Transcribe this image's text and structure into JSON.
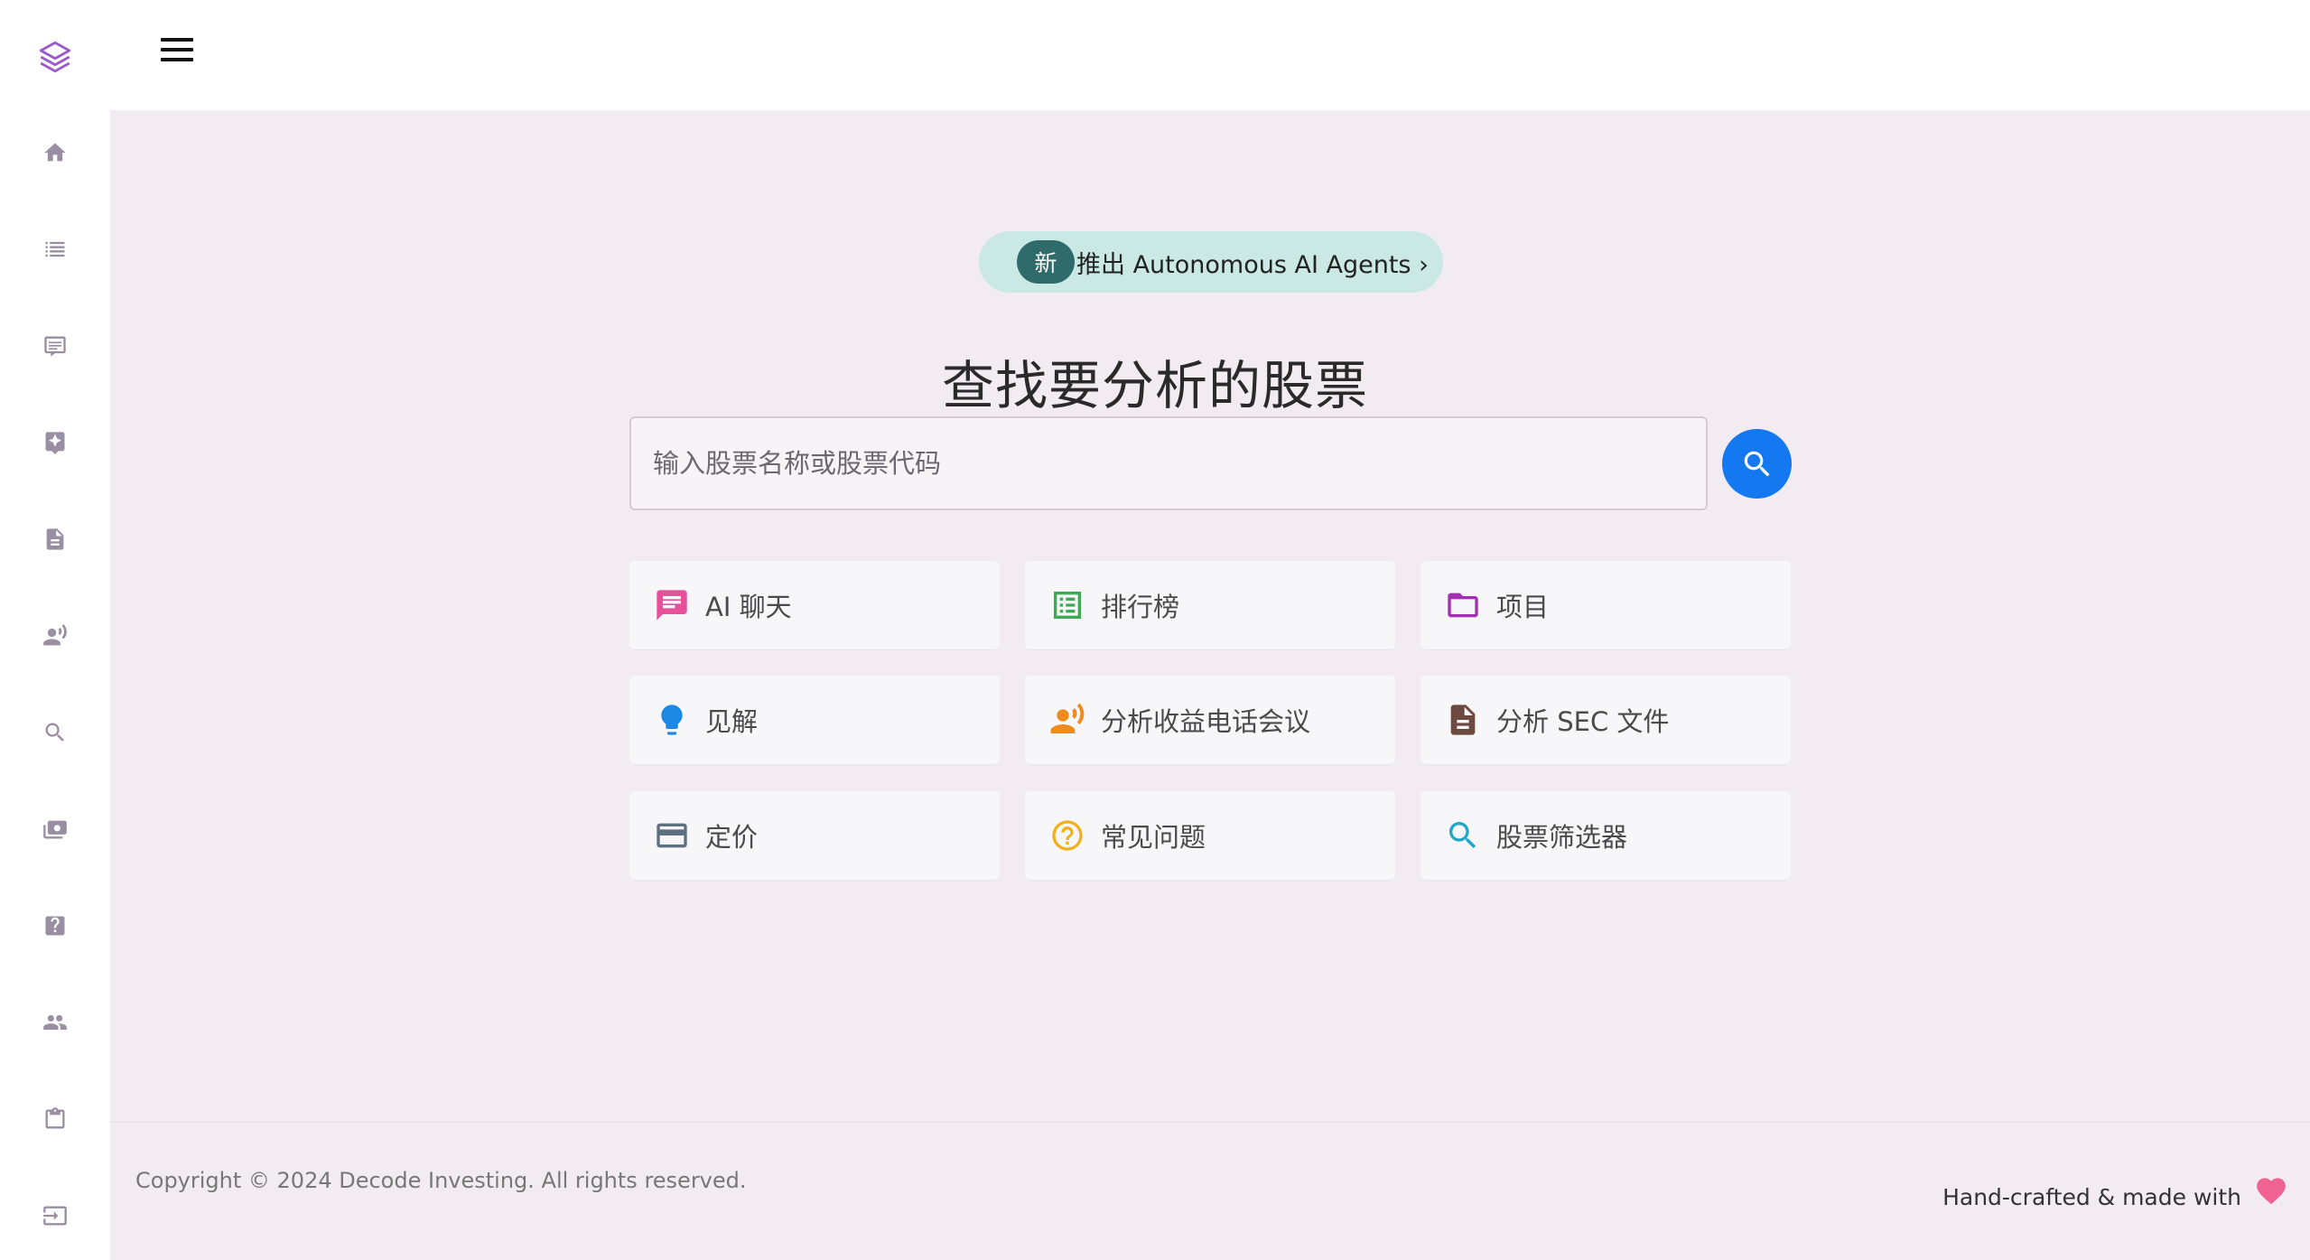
{
  "sidebar": {
    "items": [
      {
        "name": "home-icon"
      },
      {
        "name": "list-icon"
      },
      {
        "name": "chat-icon"
      },
      {
        "name": "insight-icon"
      },
      {
        "name": "document-icon"
      },
      {
        "name": "speaker-icon"
      },
      {
        "name": "search-icon"
      },
      {
        "name": "pricing-icon"
      },
      {
        "name": "help-icon"
      },
      {
        "name": "users-icon"
      },
      {
        "name": "clipboard-icon"
      },
      {
        "name": "logout-icon"
      }
    ]
  },
  "announcement": {
    "badge": "新",
    "text": "推出 Autonomous AI Agents ›"
  },
  "main": {
    "title": "查找要分析的股票",
    "search_placeholder": "输入股票名称或股票代码"
  },
  "cards": [
    {
      "label": "AI 聊天",
      "icon": "chat-icon",
      "color": "#e8509a"
    },
    {
      "label": "排行榜",
      "icon": "list-icon",
      "color": "#3eaa55"
    },
    {
      "label": "项目",
      "icon": "folder-icon",
      "color": "#a22fb0"
    },
    {
      "label": "见解",
      "icon": "lightbulb-icon",
      "color": "#1e88e5"
    },
    {
      "label": "分析收益电话会议",
      "icon": "speaker-icon",
      "color": "#f08a1c"
    },
    {
      "label": "分析 SEC 文件",
      "icon": "document-icon",
      "color": "#6d4a3f"
    },
    {
      "label": "定价",
      "icon": "credit-card-icon",
      "color": "#5d7080"
    },
    {
      "label": "常见问题",
      "icon": "help-circle-icon",
      "color": "#f2b01e"
    },
    {
      "label": "股票筛选器",
      "icon": "search-icon",
      "color": "#21a7c7"
    }
  ],
  "footer": {
    "copyright": "Copyright © 2024 Decode Investing. All rights reserved.",
    "handcrafted": "Hand-crafted & made with",
    "heart_color": "#f06292"
  },
  "colors": {
    "accent": "#1479f0",
    "sidebar_icon": "#9a8ea3",
    "logo": "#9b59c9",
    "background": "#f2ecf2"
  }
}
